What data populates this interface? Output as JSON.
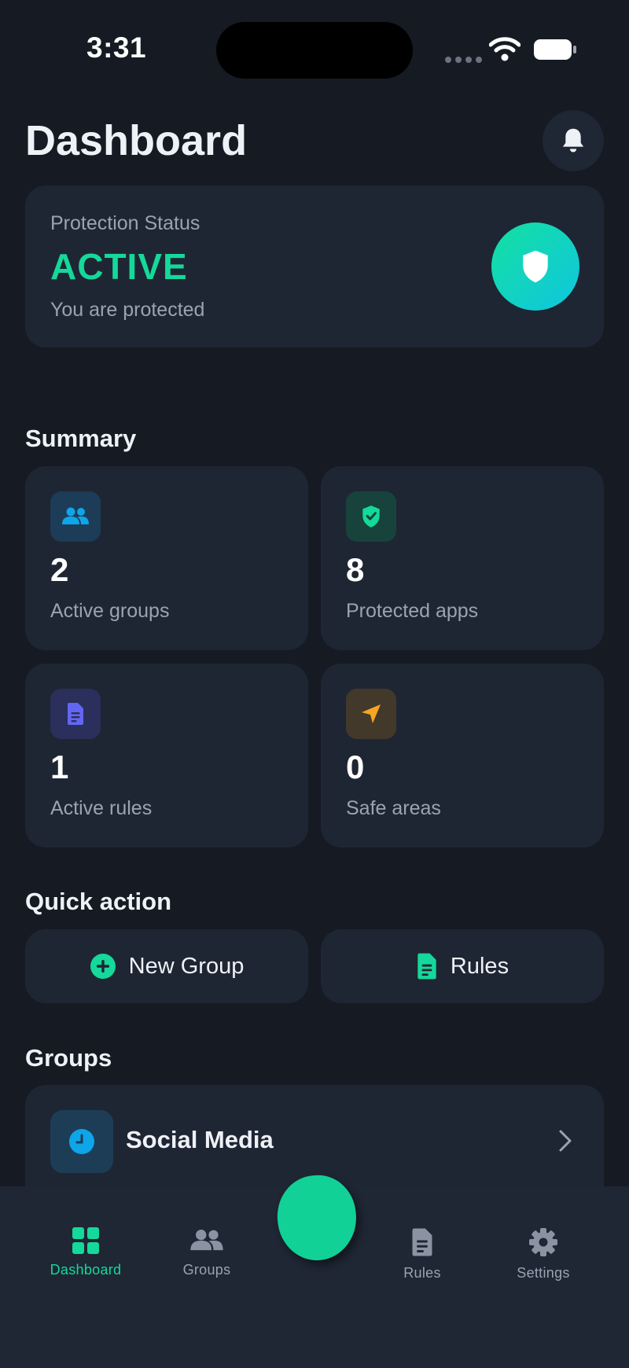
{
  "status_bar": {
    "time": "3:31"
  },
  "header": {
    "title": "Dashboard"
  },
  "protection": {
    "label": "Protection Status",
    "state": "ACTIVE",
    "subtitle": "You are protected"
  },
  "summary": {
    "title": "Summary",
    "tiles": [
      {
        "value": "2",
        "label": "Active groups",
        "icon": "users-icon",
        "color": "#0ea5e9"
      },
      {
        "value": "8",
        "label": "Protected apps",
        "icon": "shield-check-icon",
        "color": "#14d99a"
      },
      {
        "value": "1",
        "label": "Active rules",
        "icon": "document-icon",
        "color": "#6366f1"
      },
      {
        "value": "0",
        "label": "Safe areas",
        "icon": "location-arrow-icon",
        "color": "#f5a623"
      }
    ]
  },
  "quick_action": {
    "title": "Quick action",
    "new_group_label": "New Group",
    "rules_label": "Rules"
  },
  "groups": {
    "title": "Groups",
    "items": [
      {
        "name": "Social Media",
        "icon": "clock-icon"
      }
    ]
  },
  "tabbar": {
    "items": [
      {
        "label": "Dashboard",
        "icon": "grid-icon",
        "active": true
      },
      {
        "label": "Groups",
        "icon": "users-icon",
        "active": false
      },
      {
        "label": "Rules",
        "icon": "document-icon",
        "active": false
      },
      {
        "label": "Settings",
        "icon": "gear-icon",
        "active": false
      }
    ]
  },
  "colors": {
    "accent": "#14d99a",
    "background": "#151a23",
    "card": "#1f2633"
  }
}
